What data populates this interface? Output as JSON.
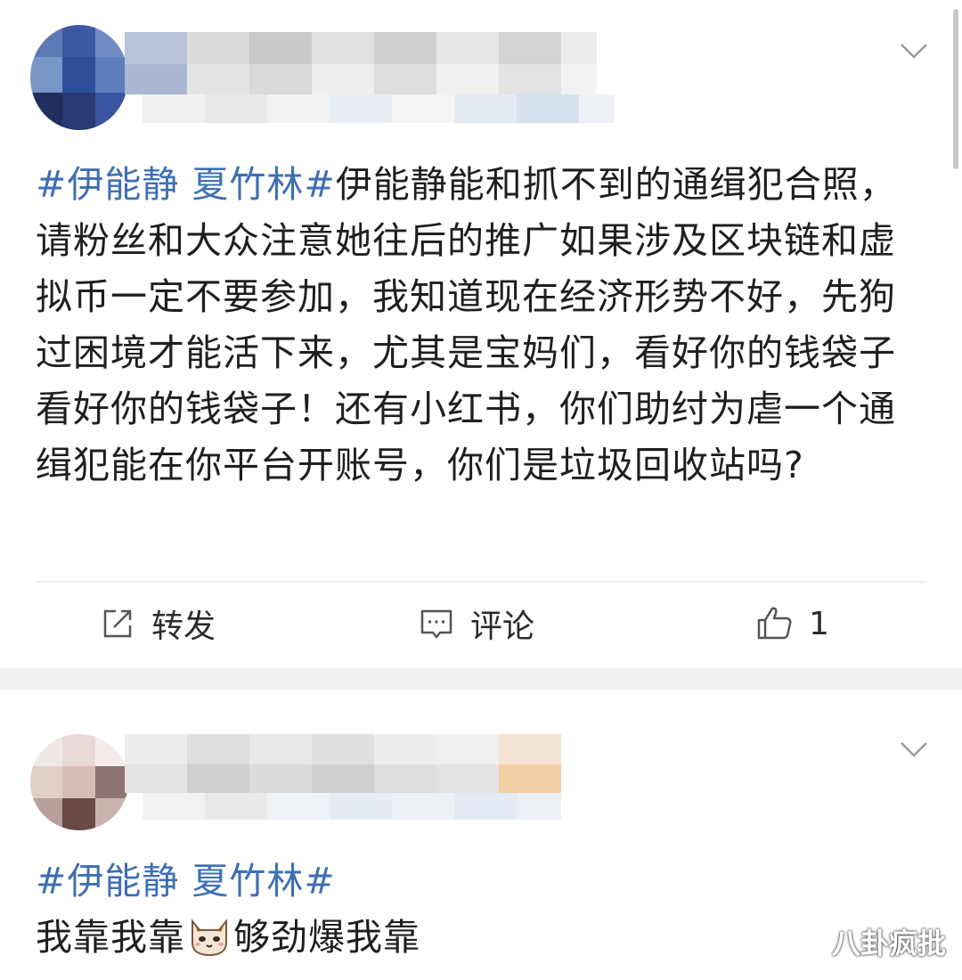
{
  "post1": {
    "hashtag": "#伊能静 夏竹林#",
    "body": "伊能静能和抓不到的通缉犯合照，请粉丝和大众注意她往后的推广如果涉及区块链和虚拟币一定不要参加，我知道现在经济形势不好，先狗过困境才能活下来，尤其是宝妈们，看好你的钱袋子看好你的钱袋子！还有小红书，你们助纣为虐一个通缉犯能在你平台开账号，你们是垃圾回收站吗?",
    "actions": {
      "repost_label": "转发",
      "comment_label": "评论",
      "like_count": "1"
    },
    "icons": {
      "repost": "share-edit-icon",
      "comment": "comment-icon",
      "like": "thumbs-up-icon",
      "menu": "chevron-down-icon"
    }
  },
  "post2": {
    "hashtag": "#伊能静 夏竹林#",
    "body_before_emoji": "我靠我靠",
    "emoji": "cat-face-emoji",
    "body_after_emoji": "够劲爆我靠",
    "icons": {
      "menu": "chevron-down-icon"
    }
  },
  "watermark": "八卦疯批",
  "colors": {
    "hashtag": "#3e6fb3",
    "text": "#1f1f1f",
    "separator": "#f1f1f1"
  }
}
